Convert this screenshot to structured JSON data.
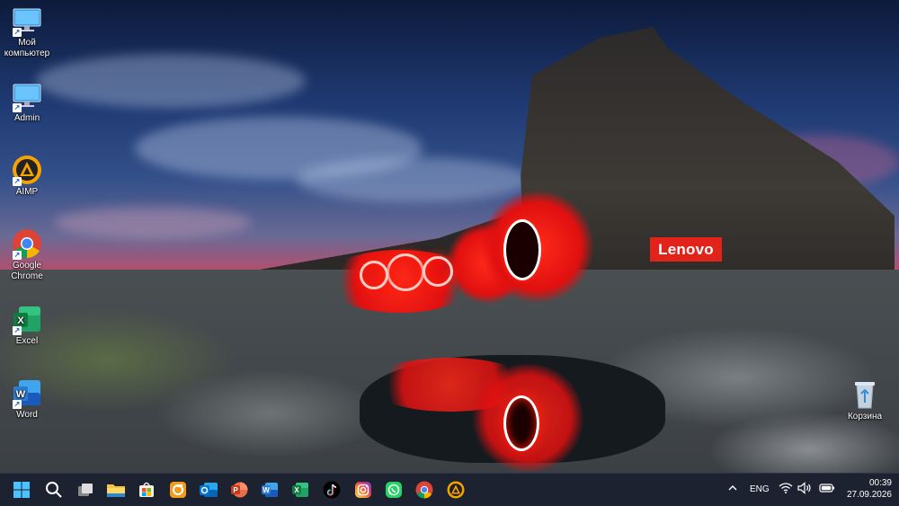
{
  "desktop": {
    "icons": [
      {
        "label": "Мой компьютер"
      },
      {
        "label": "Admin"
      },
      {
        "label": "AIMP"
      },
      {
        "label": "Google Chrome"
      },
      {
        "label": "Excel"
      },
      {
        "label": "Word"
      },
      {
        "label": "Корзина"
      }
    ],
    "wallpaper_brand": "Lenovo"
  },
  "taskbar": {
    "icons": [
      "windows-start-icon",
      "search-icon",
      "task-view-icon",
      "file-explorer-icon",
      "microsoft-store-icon",
      "photo-app-icon",
      "outlook-icon",
      "powerpoint-icon",
      "word-icon",
      "excel-icon",
      "tiktok-icon",
      "instagram-icon",
      "whatsapp-icon",
      "chrome-icon",
      "aimp-icon"
    ],
    "tray": {
      "language": "ENG",
      "time": "00:39",
      "date": "27.09.2026"
    }
  },
  "colors": {
    "taskbar_bg": "#1c2230",
    "lenovo_red": "#e2231a"
  }
}
